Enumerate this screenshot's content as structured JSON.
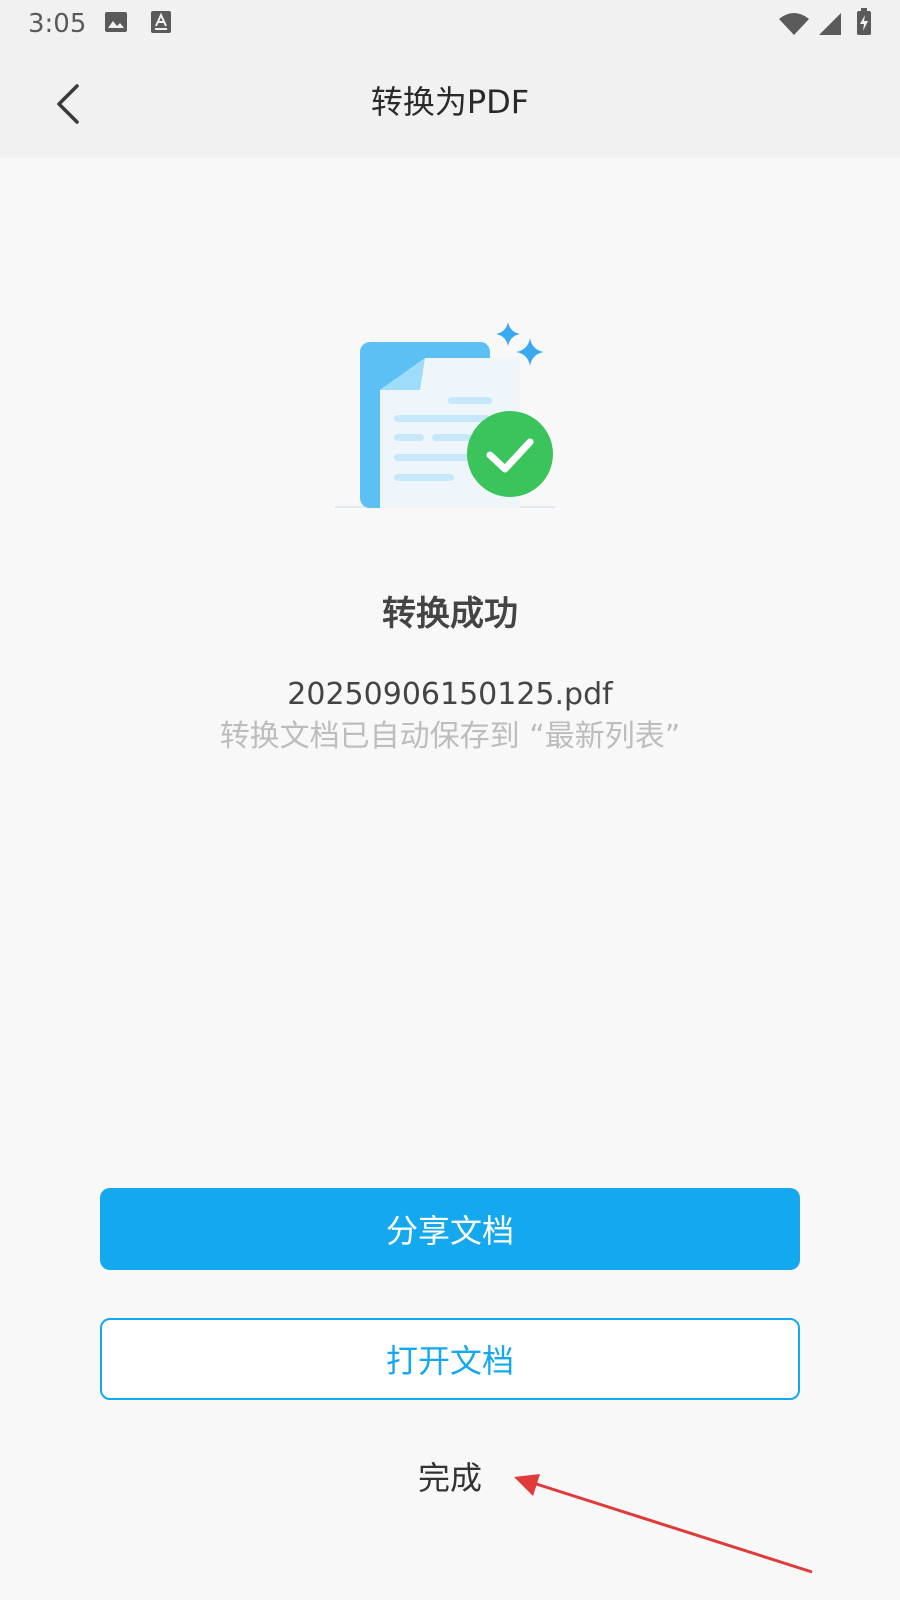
{
  "status_bar": {
    "time": "3:05",
    "icons": [
      "gallery-icon",
      "keyboard-a-icon",
      "wifi-icon",
      "cellular-signal-icon",
      "battery-charging-icon"
    ]
  },
  "header": {
    "title": "转换为PDF",
    "back_icon": "chevron-left-icon"
  },
  "result": {
    "title": "转换成功",
    "file_name": "20250906150125.pdf",
    "note": "转换文档已自动保存到 “最新列表”"
  },
  "actions": {
    "share_label": "分享文档",
    "open_label": "打开文档",
    "done_label": "完成"
  },
  "colors": {
    "accent": "#14a8ee",
    "success": "#3cc45c",
    "background": "#f8f8f8",
    "appbar": "#f1f1f1",
    "annotation": "#e03a3a"
  }
}
